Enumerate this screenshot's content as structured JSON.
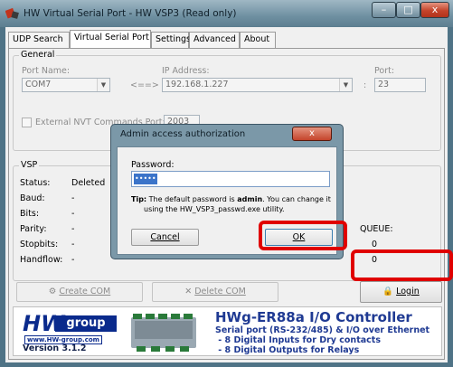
{
  "window": {
    "title": "HW Virtual Serial Port - HW VSP3 (Read only)",
    "controls": {
      "minimize": "–",
      "maximize": "□",
      "close": "x"
    }
  },
  "tabs": [
    "UDP Search",
    "Virtual Serial Port",
    "Settings",
    "Advanced",
    "About"
  ],
  "active_tab": "Virtual Serial Port",
  "general": {
    "legend": "General",
    "port_name_label": "Port Name:",
    "port_name_value": "COM7",
    "arrow": "<==>",
    "ip_label": "IP Address:",
    "ip_value": "192.168.1.227",
    "port_label": "Port:",
    "port_sep": ":",
    "port_value": "23",
    "nvt_label": "External NVT Commands Port:",
    "nvt_value": "2003"
  },
  "vsp": {
    "legend": "VSP",
    "rows": [
      {
        "label": "Status:",
        "value": "Deleted"
      },
      {
        "label": "Baud:",
        "value": "-"
      },
      {
        "label": "Bits:",
        "value": "-"
      },
      {
        "label": "Parity:",
        "value": "-"
      },
      {
        "label": "Stopbits:",
        "value": "-"
      },
      {
        "label": "Handflow:",
        "value": "-"
      }
    ],
    "queue_label": "QUEUE:",
    "queue_values": [
      "0",
      "0"
    ]
  },
  "buttons": {
    "create_com": "Create COM",
    "delete_com": "Delete COM",
    "login": "Login"
  },
  "dialog": {
    "title": "Admin access authorization",
    "close": "x",
    "password_label": "Password:",
    "password_value": "•••••",
    "tip_label": "Tip:",
    "tip_text_1": "The default password is",
    "tip_bold": "admin",
    "tip_text_2": ". You can change it",
    "tip_text_3": "using the HW_VSP3_passwd.exe utility.",
    "cancel": "Cancel",
    "ok": "OK"
  },
  "banner": {
    "logo_hw": "HW",
    "logo_group": "group",
    "logo_url": "www.HW-group.com",
    "version": "Version 3.1.2",
    "product_title": "HWg-ER88a  I/O Controller",
    "line1": "Serial port (RS-232/485) & I/O over Ethernet",
    "line2": " - 8 Digital Inputs for Dry contacts",
    "line3": " - 8 Digital Outputs for Relays"
  },
  "colors": {
    "highlight_red": "#e00000",
    "banner_blue": "#0a2a8c",
    "banner_title_blue": "#1f3a93",
    "version_dark": "#14224a"
  }
}
